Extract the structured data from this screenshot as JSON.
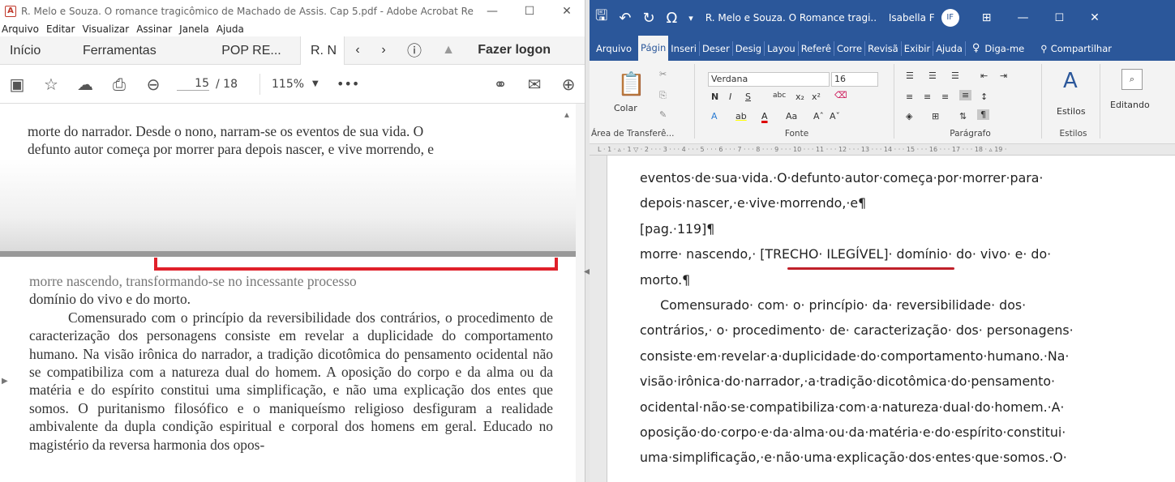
{
  "acrobat": {
    "title": "R. Melo e Souza. O romance tragicômico de Machado de Assis. Cap 5.pdf - Adobe Acrobat Rea...",
    "menu": [
      "Arquivo",
      "Editar",
      "Visualizar",
      "Assinar",
      "Janela",
      "Ajuda"
    ],
    "tabs": {
      "home": "Início",
      "tools": "Ferramentas",
      "doc1": "POP RE...",
      "doc2": "R. N",
      "login": "Fazer logon"
    },
    "page_current": "15",
    "page_total": "/ 18",
    "zoom": "115%",
    "page_top_lines": [
      "morte do narrador. Desde o nono, narram-se os eventos de sua vida. O",
      "defunto autor começa por morrer para depois nascer, e vive morrendo, e"
    ],
    "page_main_lines": [
      "morre nascendo, transformando-se no incessante processo",
      "domínio do vivo e do morto."
    ],
    "page_paragraph": "Comensurado com o princípio da reversibilidade dos contrários, o procedimento de caracterização dos personagens consiste em revelar a duplicidade do comportamento humano. Na visão irônica do narrador, a tradição dicotômica do pensamento ocidental não se compatibiliza com a natureza dual do homem. A oposição do corpo e da alma ou da matéria e do espírito constitui uma simplificação, e não uma explicação dos entes que somos. O puritanismo filosófico e o maniqueísmo religioso desfiguram a realidade ambivalente da dupla condição espiritual e corporal dos homens em geral. Educado no magistério da reversa harmonia dos opos-"
  },
  "word": {
    "title": "R. Melo e Souza. O Romance tragi...",
    "user": "Isabella F",
    "user_initials": "IF",
    "tabs": [
      "Arquivo",
      "Págin",
      "Inseri",
      "Deser",
      "Desig",
      "Layou",
      "Referê",
      "Corre",
      "Revisã",
      "Exibir",
      "Ajuda"
    ],
    "tell_me": "Diga-me",
    "share": "Compartilhar",
    "font_name": "Verdana",
    "font_size": "16",
    "groups": {
      "clipboard": "Área de Transferê...",
      "font": "Fonte",
      "paragraph": "Parágrafo",
      "styles": "Estilos"
    },
    "paste": "Colar",
    "styles_btn": "Estilos",
    "editing_btn": "Editando",
    "doc_lines": [
      "eventos·de·sua·vida.·O·defunto·autor·começa·por·morrer·para·",
      "depois·nascer,·e·vive·morrendo,·e¶",
      "[pag.·119]¶",
      "morre· nascendo,· [TRECHO· ILEGÍVEL]· domínio· do· vivo· e· do·",
      "morto.¶",
      "     Comensurado· com· o· princípio· da· reversibilidade· dos·",
      "contrários,· o· procedimento· de· caracterização· dos· personagens·",
      "consiste·em·revelar·a·duplicidade·do·comportamento·humano.·Na·",
      "visão·irônica·do·narrador,·a·tradição·dicotômica·do·pensamento·",
      "ocidental·não·se·compatibiliza·com·a·natureza·dual·do·homem.·A·",
      "oposição·do·corpo·e·da·alma·ou·da·matéria·e·do·espírito·constitui·",
      "uma·simplificação,·e·não·uma·explicação·dos·entes·que·somos.·O·"
    ]
  }
}
